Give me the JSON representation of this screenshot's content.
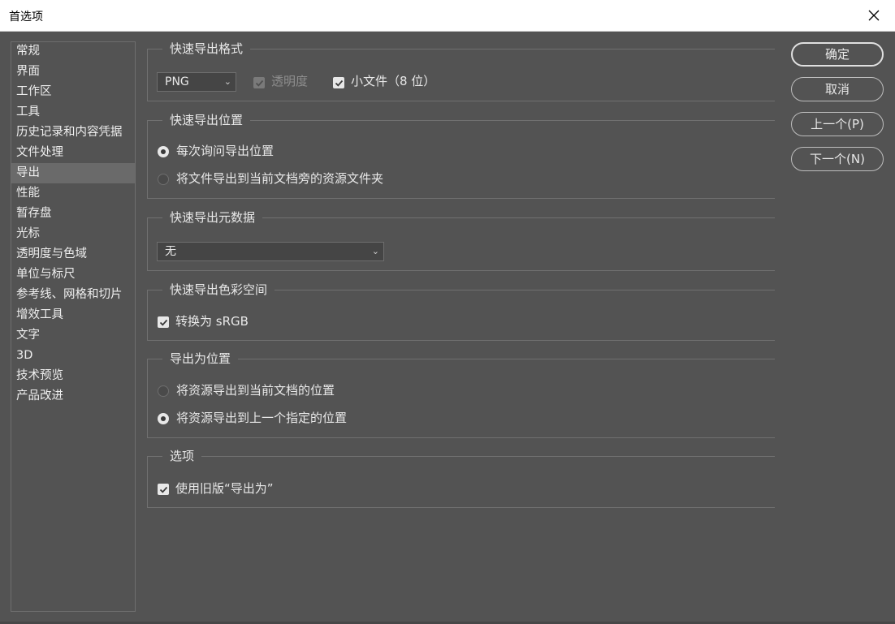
{
  "window": {
    "title": "首选项"
  },
  "sidebar": {
    "items": [
      {
        "label": "常规"
      },
      {
        "label": "界面"
      },
      {
        "label": "工作区"
      },
      {
        "label": "工具"
      },
      {
        "label": "历史记录和内容凭据"
      },
      {
        "label": "文件处理"
      },
      {
        "label": "导出",
        "selected": true
      },
      {
        "label": "性能"
      },
      {
        "label": "暂存盘"
      },
      {
        "label": "光标"
      },
      {
        "label": "透明度与色域"
      },
      {
        "label": "单位与标尺"
      },
      {
        "label": "参考线、网格和切片"
      },
      {
        "label": "增效工具"
      },
      {
        "label": "文字"
      },
      {
        "label": "3D"
      },
      {
        "label": "技术预览"
      },
      {
        "label": "产品改进"
      }
    ]
  },
  "groups": {
    "format": {
      "title": "快速导出格式",
      "format_value": "PNG",
      "transparency_label": "透明度",
      "transparency_checked": true,
      "transparency_disabled": true,
      "small_file_label": "小文件（8 位）",
      "small_file_checked": true
    },
    "location": {
      "title": "快速导出位置",
      "option_ask": "每次询问导出位置",
      "option_assets": "将文件导出到当前文档旁的资源文件夹",
      "selected": "ask"
    },
    "metadata": {
      "title": "快速导出元数据",
      "value": "无"
    },
    "colorspace": {
      "title": "快速导出色彩空间",
      "convert_label": "转换为 sRGB",
      "convert_checked": true
    },
    "export_as": {
      "title": "导出为位置",
      "option_current": "将资源导出到当前文档的位置",
      "option_last": "将资源导出到上一个指定的位置",
      "selected": "last"
    },
    "options": {
      "title": "选项",
      "legacy_label": "使用旧版“导出为”",
      "legacy_checked": true
    }
  },
  "buttons": {
    "ok": "确定",
    "cancel": "取消",
    "prev": "上一个(P)",
    "next": "下一个(N)"
  },
  "colors": {
    "background": "#535353",
    "titlebar": "#ffffff",
    "selection": "#6a6a6a"
  },
  "icons": {
    "close": "close-icon",
    "dropdown": "chevron-down-icon",
    "check": "checkmark-icon"
  }
}
